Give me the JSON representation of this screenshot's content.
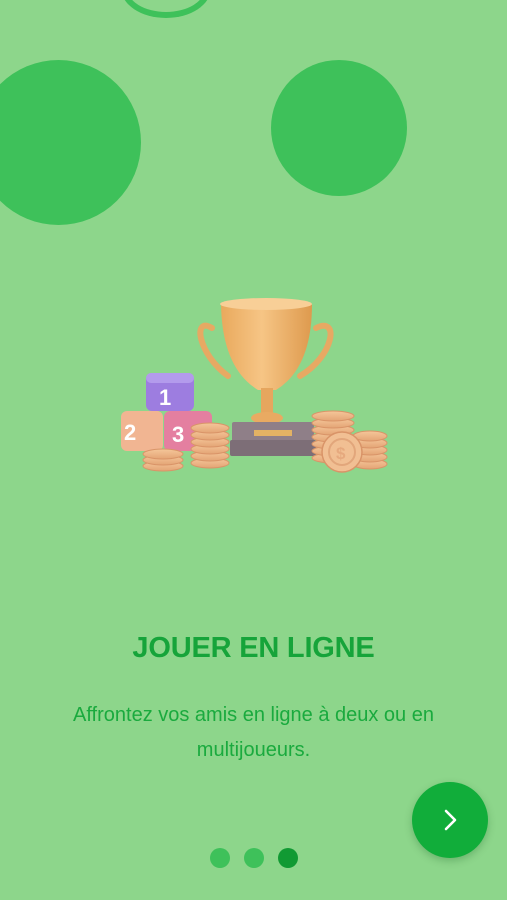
{
  "onboarding": {
    "title": "JOUER EN LIGNE",
    "description": "Affrontez vos amis en ligne à deux ou en multijoueurs.",
    "illustration": "trophy-podium-coins",
    "page_indicator": {
      "total": 3,
      "current": 3
    },
    "next_button_icon": "chevron-right-icon"
  },
  "colors": {
    "background": "#8dd68b",
    "bubble": "#3ec15a",
    "accent": "#11ad3a",
    "title": "#16a43a"
  }
}
